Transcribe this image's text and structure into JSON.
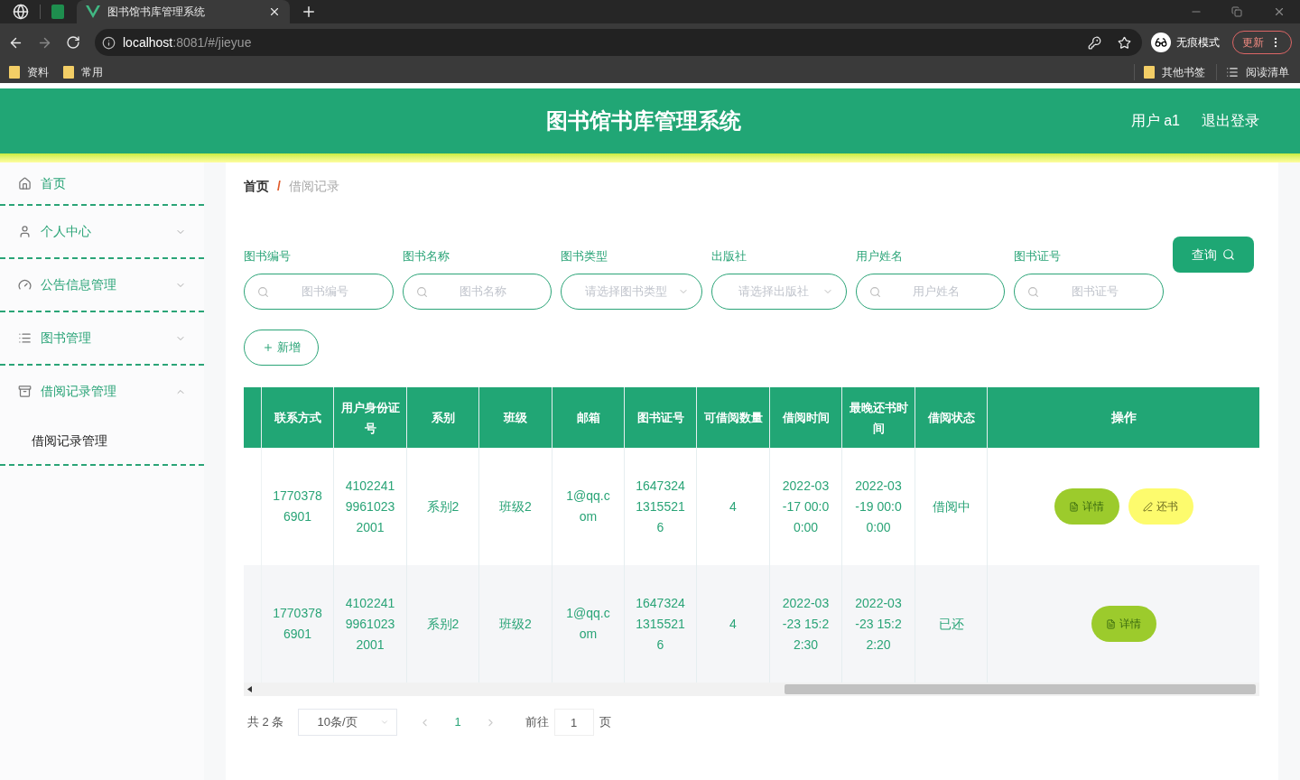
{
  "browser": {
    "tab_title": "图书馆书库管理系统",
    "url_host": "localhost",
    "url_path": ":8081/#/jieyue",
    "incognito_label": "无痕模式",
    "update_label": "更新",
    "bookmarks": [
      "资料",
      "常用"
    ],
    "bookmarks_right": [
      {
        "kind": "folder",
        "label": "其他书签"
      },
      {
        "kind": "list",
        "label": "阅读清单"
      }
    ]
  },
  "header": {
    "title": "图书馆书库管理系统",
    "user": "用户 a1",
    "logout": "退出登录"
  },
  "sidebar": {
    "items": [
      {
        "label": "首页",
        "has_children": false,
        "expanded": false
      },
      {
        "label": "个人中心",
        "has_children": true,
        "expanded": false
      },
      {
        "label": "公告信息管理",
        "has_children": true,
        "expanded": false
      },
      {
        "label": "图书管理",
        "has_children": true,
        "expanded": false
      },
      {
        "label": "借阅记录管理",
        "has_children": true,
        "expanded": true,
        "children": [
          {
            "label": "借阅记录管理",
            "selected": true
          }
        ]
      }
    ]
  },
  "breadcrumb": {
    "home": "首页",
    "separator": "/",
    "current": "借阅记录"
  },
  "filters": [
    {
      "kind": "input",
      "label": "图书编号",
      "placeholder": "图书编号"
    },
    {
      "kind": "input",
      "label": "图书名称",
      "placeholder": "图书名称"
    },
    {
      "kind": "select",
      "label": "图书类型",
      "placeholder": "请选择图书类型"
    },
    {
      "kind": "select",
      "label": "出版社",
      "placeholder": "请选择出版社"
    },
    {
      "kind": "input",
      "label": "用户姓名",
      "placeholder": "用户姓名"
    },
    {
      "kind": "input",
      "label": "图书证号",
      "placeholder": "图书证号"
    }
  ],
  "query_button": "查询",
  "add_button": "新增",
  "table": {
    "columns": [
      "联系方式",
      "用户身份证号",
      "系别",
      "班级",
      "邮箱",
      "图书证号",
      "可借阅数量",
      "借阅时间",
      "最晚还书时间",
      "借阅状态",
      "操作"
    ],
    "rows": [
      {
        "cells": [
          "17703786901",
          "410224199610232001",
          "系别2",
          "班级2",
          "1@qq.com",
          "164732413155216",
          "4",
          "2022-03-17 00:00:00",
          "2022-03-19 00:00:00",
          "借阅中"
        ],
        "actions": [
          {
            "kind": "detail",
            "label": "详情"
          },
          {
            "kind": "return",
            "label": "还书"
          }
        ]
      },
      {
        "cells": [
          "17703786901",
          "410224199610232001",
          "系别2",
          "班级2",
          "1@qq.com",
          "164732413155216",
          "4",
          "2022-03-23 15:22:30",
          "2022-03-23 15:22:20",
          "已还"
        ],
        "actions": [
          {
            "kind": "detail",
            "label": "详情"
          }
        ]
      }
    ]
  },
  "pagination": {
    "total": "共 2 条",
    "page_size": "10条/页",
    "pages": [
      {
        "label": "1",
        "selected": true
      }
    ],
    "goto_label": "前往",
    "goto_value": "1",
    "page_suffix": "页"
  }
}
